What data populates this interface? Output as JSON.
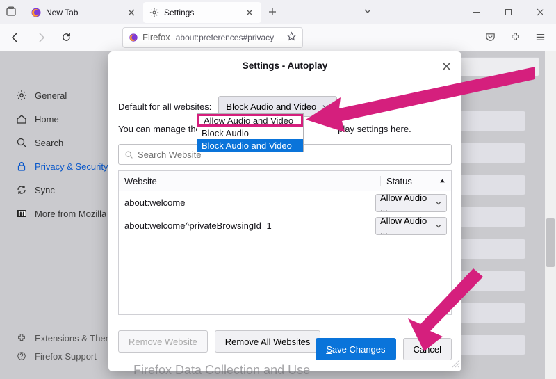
{
  "tabs": [
    {
      "title": "New Tab"
    },
    {
      "title": "Settings"
    }
  ],
  "urlbar": {
    "identity": "Firefox",
    "url": "about:preferences#privacy"
  },
  "sidebar": {
    "items": [
      {
        "id": "general",
        "label": "General"
      },
      {
        "id": "home",
        "label": "Home"
      },
      {
        "id": "search",
        "label": "Search"
      },
      {
        "id": "privacy",
        "label": "Privacy & Security"
      },
      {
        "id": "sync",
        "label": "Sync"
      },
      {
        "id": "more",
        "label": "More from Mozilla"
      }
    ],
    "footer": [
      {
        "id": "ext",
        "label": "Extensions & Themes"
      },
      {
        "id": "support",
        "label": "Firefox Support"
      }
    ]
  },
  "dialog": {
    "title": "Settings - Autoplay",
    "default_label": "Default for all websites:",
    "default_value": "Block Audio and Video",
    "manage_text_before": "You can manage the site",
    "manage_text_after": "play settings here.",
    "search_placeholder": "Search Website",
    "columns": {
      "website": "Website",
      "status": "Status"
    },
    "rows": [
      {
        "site": "about:welcome",
        "status": "Allow Audio ..."
      },
      {
        "site": "about:welcome^privateBrowsingId=1",
        "status": "Allow Audio ..."
      }
    ],
    "dropdown_options": [
      "Allow Audio and Video",
      "Block Audio",
      "Block Audio and Video"
    ],
    "buttons": {
      "remove": "Remove Website",
      "remove_all": "Remove All Websites",
      "save1": "S",
      "save2": "ave Changes",
      "cancel": "Cancel"
    }
  },
  "page_bottom_text": "Firefox Data Collection and Use"
}
